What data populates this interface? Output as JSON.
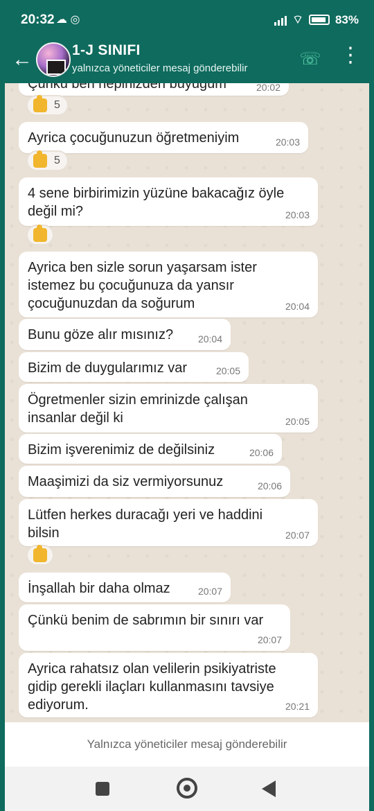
{
  "status": {
    "time": "20:32",
    "icons": "☁ ◎",
    "battery": "83%"
  },
  "header": {
    "back_icon": "arrow-left-icon",
    "title": "1-J SINIFI",
    "subtitle": "yalnızca yöneticiler mesaj gönderebilir",
    "call_icon": "add-call-icon",
    "menu_icon": "more-vertical-icon"
  },
  "messages": [
    {
      "text": "Çünkü ben hepinizden büyüğüm",
      "time": "20:02",
      "reaction": {
        "emoji": "thumbs-up-icon",
        "count": "5"
      }
    },
    {
      "text": "Ayrica çocuğunuzun öğretmeniyim",
      "time": "20:03",
      "reaction": {
        "emoji": "thumbs-up-icon",
        "count": "5"
      }
    },
    {
      "text": "4 sene birbirimizin yüzüne bakacağız öyle değil mi?",
      "time": "20:03",
      "reaction": {
        "emoji": "thumbs-up-icon",
        "count": ""
      }
    },
    {
      "text": "Ayrica ben sizle sorun yaşarsam ister istemez bu çocuğunuza da yansır çocuğunuzdan da soğurum",
      "time": "20:04"
    },
    {
      "text": "Bunu göze alır mısınız?",
      "time": "20:04"
    },
    {
      "text": "Bizim de duygularımız var",
      "time": "20:05"
    },
    {
      "text": "Ögretmenler sizin emrinizde çalışan insanlar değil ki",
      "time": "20:05"
    },
    {
      "text": "Bizim işverenimiz de değilsiniz",
      "time": "20:06"
    },
    {
      "text": "Maaşimizi da siz vermiyorsunuz",
      "time": "20:06"
    },
    {
      "text": "Lütfen herkes duracağı yeri ve haddini bilsin",
      "time": "20:07",
      "reaction": {
        "emoji": "thumbs-up-icon",
        "count": ""
      }
    },
    {
      "text": "İnşallah bir daha olmaz",
      "time": "20:07"
    },
    {
      "text": "Çünkü benim de sabrımın bir sınırı var",
      "time": "20:07"
    },
    {
      "text": "Ayrica rahatsız olan velilerin psikiyatriste gidip gerekli ilaçları kullanmasını tavsiye ediyorum.",
      "time": "20:21"
    }
  ],
  "footer": {
    "notice": "Yalnızca yöneticiler mesaj gönderebilir"
  },
  "colors": {
    "header": "#0f6b5e",
    "chat_bg": "#eae1d6",
    "bubble": "#ffffff",
    "call_icon": "#5bd0a9"
  }
}
